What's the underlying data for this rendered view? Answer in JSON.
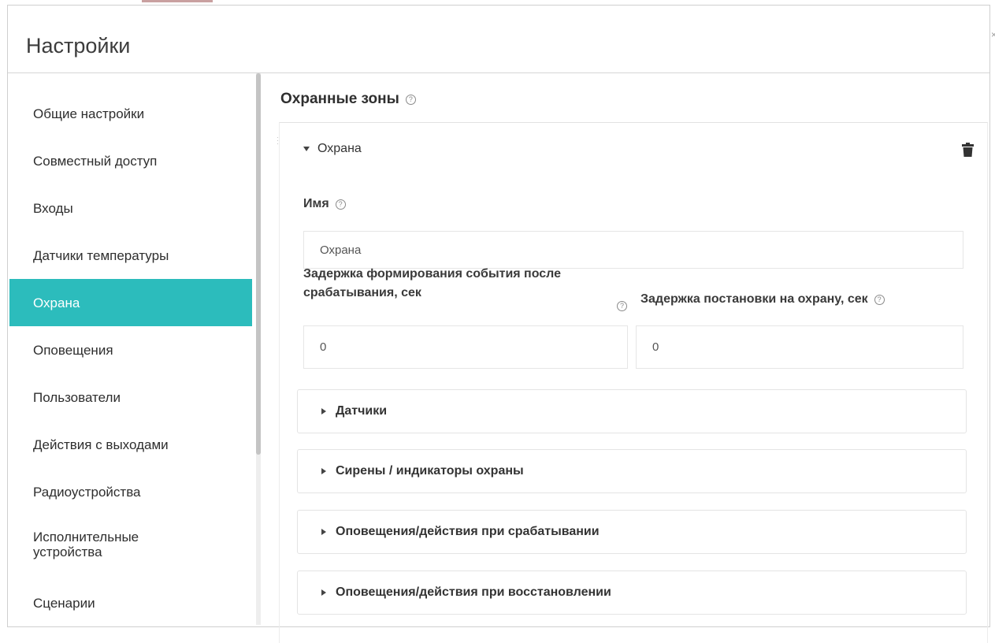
{
  "window": {
    "title": "Настройки",
    "close_label": "×"
  },
  "sidebar": {
    "items": [
      {
        "label": "Общие настройки",
        "active": false
      },
      {
        "label": "Совместный доступ",
        "active": false
      },
      {
        "label": "Входы",
        "active": false
      },
      {
        "label": "Датчики температуры",
        "active": false
      },
      {
        "label": "Охрана",
        "active": true
      },
      {
        "label": "Оповещения",
        "active": false
      },
      {
        "label": "Пользователи",
        "active": false
      },
      {
        "label": "Действия с выходами",
        "active": false
      },
      {
        "label": "Радиоустройства",
        "active": false
      },
      {
        "label": "Исполнительные устройства",
        "active": false
      },
      {
        "label": "Сценарии",
        "active": false
      }
    ]
  },
  "main": {
    "section_title": "Охранные зоны",
    "help_glyph": "?",
    "zone": {
      "header": "Охрана",
      "name_label": "Имя",
      "name_value": "Охрана",
      "delay_event_label": "Задержка формирования события после срабатывания, сек",
      "delay_event_value": "0",
      "delay_arm_label": "Задержка постановки на охрану, сек",
      "delay_arm_value": "0",
      "accordions": [
        "Датчики",
        "Сирены / индикаторы охраны",
        "Оповещения/действия при срабатывании",
        "Оповещения/действия при восстановлении"
      ]
    }
  },
  "colors": {
    "accent": "#2cbcbc",
    "text": "#333333",
    "border": "#e4e4e4"
  }
}
